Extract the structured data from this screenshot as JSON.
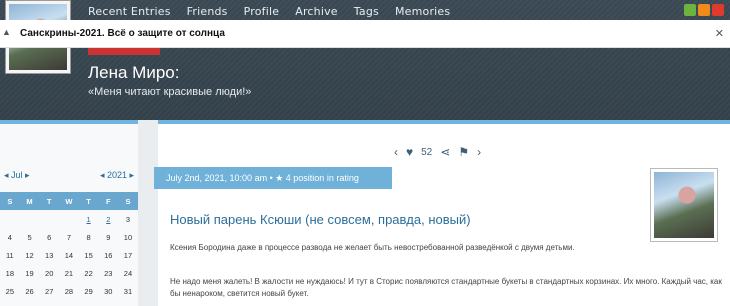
{
  "nav": {
    "items": [
      "Recent Entries",
      "Friends",
      "Profile",
      "Archive",
      "Tags",
      "Memories"
    ]
  },
  "notification": {
    "title": "Санскрины-2021. Всё о защите от солнца",
    "close_icon": "close-icon"
  },
  "blog": {
    "name": "Лена Миро:",
    "tagline": "«Меня читают красивые люди!»"
  },
  "calendar": {
    "month": "◂ Jul ▸",
    "year": "◂ 2021 ▸",
    "weekdays": [
      "S",
      "M",
      "T",
      "W",
      "T",
      "F",
      "S"
    ],
    "weeks": [
      [
        "",
        "",
        "",
        "",
        "1",
        "2",
        "3"
      ],
      [
        "4",
        "5",
        "6",
        "7",
        "8",
        "9",
        "10"
      ],
      [
        "11",
        "12",
        "13",
        "14",
        "15",
        "16",
        "17"
      ],
      [
        "18",
        "19",
        "20",
        "21",
        "22",
        "23",
        "24"
      ],
      [
        "25",
        "26",
        "27",
        "28",
        "29",
        "30",
        "31"
      ]
    ],
    "linked_days": [
      "1",
      "2"
    ]
  },
  "post": {
    "likes": "52",
    "date_line": "July 2nd, 2021, 10:00 am • ★ 4 position in rating",
    "title": "Новый парень Ксюши (не совсем, правда, новый)",
    "para1": "Ксения Бородина даже в процессе развода не желает быть невостребованной разведёнкой с двумя детьми.",
    "para2": "Не надо меня жалеть! В жалости не нуждаюсь! И тут в Сторис появляются стандартные букеты в стандартных корзинах. Их много. Каждый час, как бы ненароком, светится новый букет."
  },
  "colors": {
    "header_dark": "#34424c",
    "accent_blue": "#6fb1d9",
    "link_blue": "#2c6e9b"
  }
}
